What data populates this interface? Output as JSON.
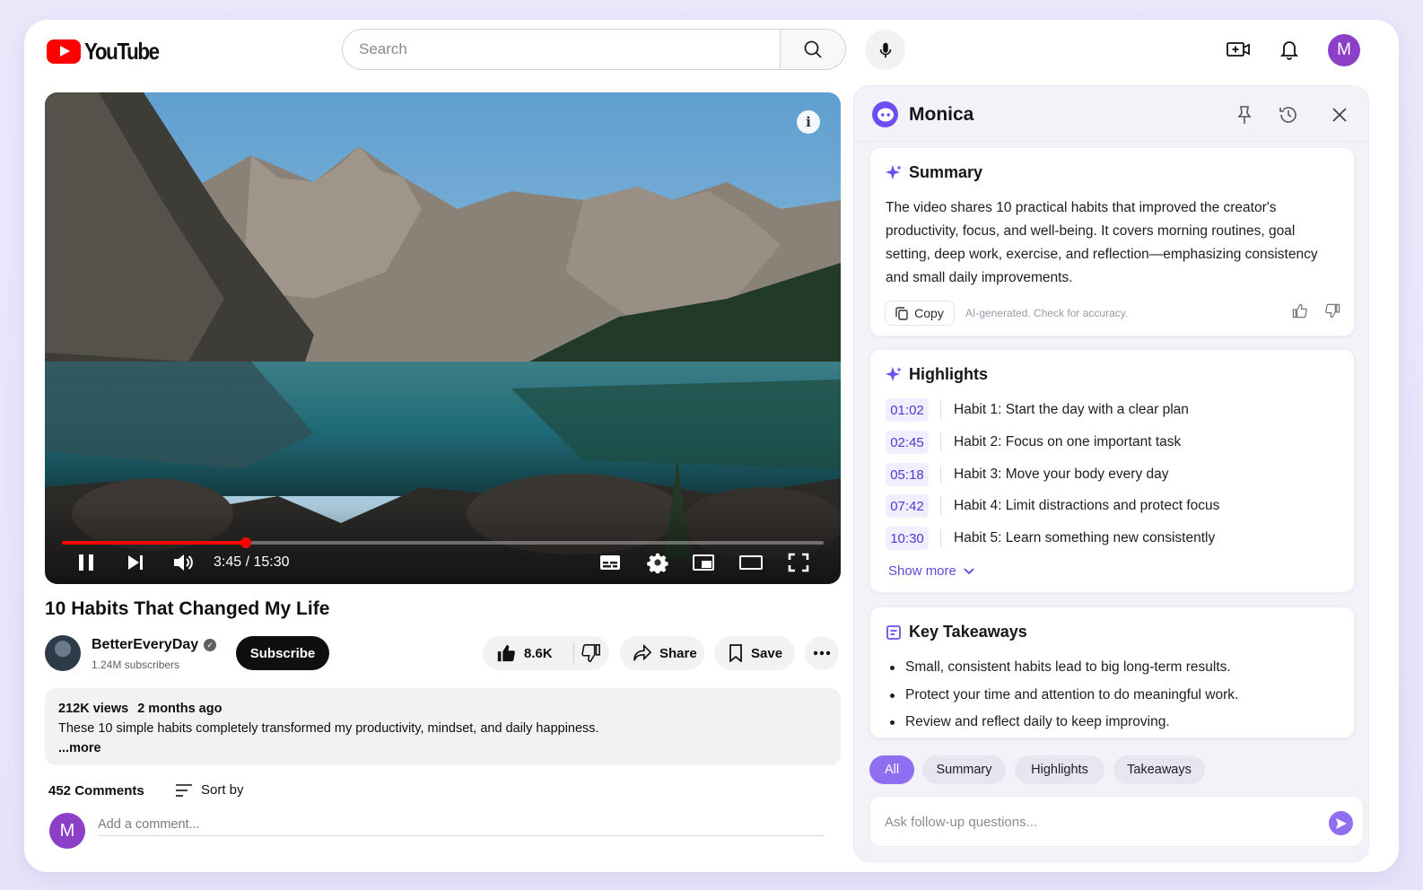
{
  "colors": {
    "youtube_red": "#ff0000",
    "monica_accent": "#8f6ef2",
    "avatar_purple": "#8d3fc8",
    "timestamp_text": "#4a3bd1"
  },
  "header": {
    "logo_text": "YouTube",
    "search_placeholder": "Search",
    "icons": [
      "search-icon",
      "mic-icon",
      "create-video-icon",
      "bell-icon"
    ],
    "avatar_letter": "M"
  },
  "player": {
    "info_glyph": "i",
    "progress_fraction": 0.242,
    "time_display": "3:45 / 15:30",
    "controls": [
      "pause-icon",
      "next-icon",
      "volume-icon",
      "subtitles-icon",
      "settings-icon",
      "miniplayer-icon",
      "theater-icon",
      "fullscreen-icon"
    ]
  },
  "video": {
    "title": "10 Habits That Changed My Life",
    "channel_name": "BetterEveryDay",
    "verified_mark": "✓",
    "subscribers": "1.24M subscribers",
    "subscribe_label": "Subscribe",
    "likes": "8.6K",
    "share_label": "Share",
    "save_label": "Save",
    "views": "212K views",
    "age": "2 months ago",
    "description": "These 10 simple habits completely transformed my productivity, mindset, and daily happiness.",
    "more_label": "...more"
  },
  "comments": {
    "count_label": "452 Comments",
    "sort_label": "Sort by",
    "avatar_letter": "M",
    "placeholder": "Add a comment..."
  },
  "monica": {
    "title": "Monica",
    "summary": {
      "heading": "Summary",
      "text": "The video shares 10 practical habits that improved the creator's productivity, focus, and well-being. It covers morning routines, goal setting, deep work, exercise, and reflection—emphasizing consistency and small daily improvements.",
      "copy_label": "Copy",
      "disclaimer": "AI-generated. Check for accuracy."
    },
    "highlights": {
      "heading": "Highlights",
      "items": [
        {
          "time": "01:02",
          "text": "Habit 1: Start the day with a clear plan"
        },
        {
          "time": "02:45",
          "text": "Habit 2: Focus on one important task"
        },
        {
          "time": "05:18",
          "text": "Habit 3: Move your body every day"
        },
        {
          "time": "07:42",
          "text": "Habit 4: Limit distractions and protect focus"
        },
        {
          "time": "10:30",
          "text": "Habit 5: Learn something new consistently"
        }
      ],
      "show_more_label": "Show more"
    },
    "takeaways": {
      "heading": "Key Takeaways",
      "items": [
        "Small, consistent habits lead to big long-term results.",
        "Protect your time and attention to do meaningful work.",
        "Review and reflect daily to keep improving."
      ]
    },
    "tabs": [
      {
        "label": "All",
        "active": true
      },
      {
        "label": "Summary",
        "active": false
      },
      {
        "label": "Highlights",
        "active": false
      },
      {
        "label": "Takeaways",
        "active": false
      }
    ],
    "ask_placeholder": "Ask follow-up questions..."
  }
}
